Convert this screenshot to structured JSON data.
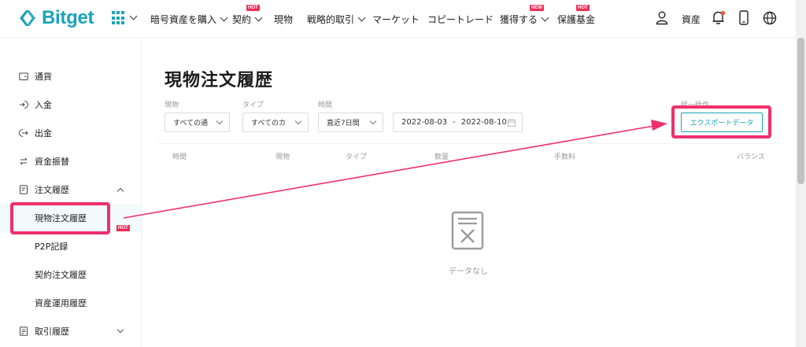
{
  "brand": {
    "name": "Bitget",
    "color": "#1aa3b8"
  },
  "nav": {
    "items": [
      {
        "label": "暗号資産を購入",
        "chevron": true
      },
      {
        "label": "契約",
        "chevron": true,
        "badge": "HOT"
      },
      {
        "label": "現物",
        "chevron": false
      },
      {
        "label": "戦略的取引",
        "chevron": true
      },
      {
        "label": "マーケット",
        "chevron": false
      },
      {
        "label": "コピートレード",
        "chevron": false
      },
      {
        "label": "獲得する",
        "chevron": true,
        "badge": "NEW"
      },
      {
        "label": "保護基金",
        "chevron": false,
        "badge": "HOT"
      }
    ],
    "asset_label": "資産",
    "icons": [
      "user-icon",
      "bell-icon",
      "mobile-icon",
      "globe-icon"
    ]
  },
  "sidebar": {
    "items": [
      {
        "label": "通貨",
        "icon": "wallet-icon"
      },
      {
        "label": "入金",
        "icon": "deposit-icon"
      },
      {
        "label": "出金",
        "icon": "withdraw-icon"
      },
      {
        "label": "資金振替",
        "icon": "transfer-icon"
      },
      {
        "label": "注文履歴",
        "icon": "order-history-icon",
        "expanded": true
      },
      {
        "label": "取引履歴",
        "icon": "trade-history-icon",
        "expanded": false
      }
    ],
    "sub_items": [
      {
        "label": "現物注文履歴",
        "active": true
      },
      {
        "label": "P2P記録"
      },
      {
        "label": "契約注文履歴",
        "badge": "HOT"
      },
      {
        "label": "資産運用履歴"
      }
    ]
  },
  "main": {
    "title": "現物注文履歴",
    "filters": {
      "spot": {
        "label": "現物",
        "value": "すべての通"
      },
      "type": {
        "label": "タイプ",
        "value": "すべてのカ"
      },
      "time": {
        "label": "時間",
        "value": "直近7日間"
      },
      "date_start": "2022-08-03",
      "date_sep": "-",
      "date_end": "2022-08-10"
    },
    "operation_label": "統一操作",
    "export_button": "エクスポートデータ",
    "columns": [
      "時間",
      "現物",
      "タイプ",
      "数量",
      "手数料",
      "バランス"
    ],
    "empty_text": "データなし"
  },
  "colors": {
    "accent": "#1aa3b8",
    "highlight": "#f0306c",
    "badge": "#ef2d56"
  }
}
